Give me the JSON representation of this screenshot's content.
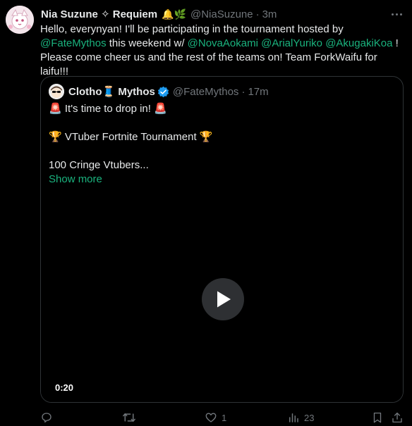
{
  "post": {
    "author_name": "Nia Suzune ✧ Requiem",
    "name_emojis": "🔔🌿",
    "handle": "@NiaSuzune",
    "separator": "·",
    "time": "3m",
    "text": {
      "line1": "Hello, everynyan! I'll be participating in the tournament hosted by",
      "mention_host": "@FateMythos",
      "line2_mid": " this weekend w/ ",
      "mention_1": "@NovaAokami",
      "mention_2": "@ArialYuriko",
      "mention_3": "@AkugakiKoa",
      "line2_end": " !",
      "line3": "Please come cheer us and the rest of the teams on! Team ForkWaifu for laifu!!!"
    }
  },
  "quote": {
    "author_name_a": "Clotho",
    "author_name_emoji": "🧵",
    "author_name_b": " Mythos",
    "handle": "@FateMythos",
    "separator": "·",
    "time": "17m",
    "line1_emoji_left": "🚨",
    "line1_text": " It's time to drop in! ",
    "line1_emoji_right": "🚨",
    "line2_emoji_left": "🏆",
    "line2_text": " VTuber Fortnite Tournament ",
    "line2_emoji_right": "🏆",
    "line3_text": "100 Cringe Vtubers...",
    "show_more": "Show more",
    "video_time": "0:20"
  },
  "actions": {
    "reply_count": "",
    "repost_count": "",
    "like_count": "1",
    "views_count": "23"
  },
  "colors": {
    "background": "#000000",
    "text": "#e7e9ea",
    "muted": "#71767b",
    "mention": "#1ab37e",
    "border": "#2f3336",
    "verified": "#1d9bf0"
  },
  "icons": [
    "avatar-icon",
    "more-icon",
    "verified-icon",
    "play-icon",
    "reply-icon",
    "repost-icon",
    "like-icon",
    "views-icon",
    "bookmark-icon",
    "share-icon"
  ]
}
